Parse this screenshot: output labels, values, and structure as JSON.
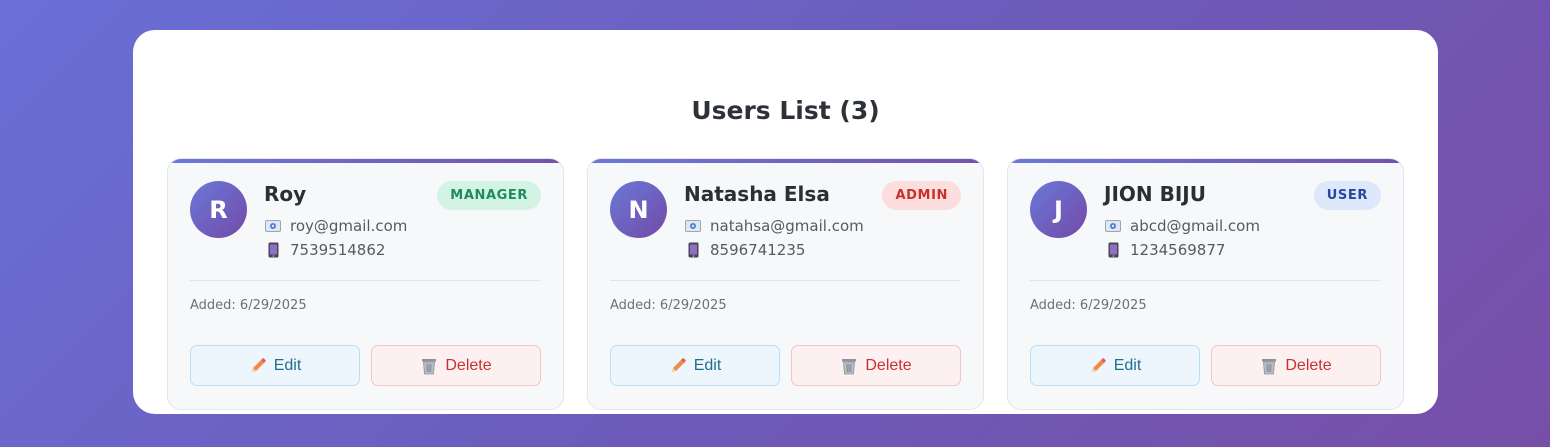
{
  "page": {
    "title": "Users List (3)"
  },
  "users": [
    {
      "initial": "R",
      "name": "Roy",
      "role": "MANAGER",
      "email": "roy@gmail.com",
      "phone": "7539514862",
      "added": "Added: 6/29/2025",
      "edit_label": "Edit",
      "delete_label": "Delete"
    },
    {
      "initial": "N",
      "name": "Natasha Elsa",
      "role": "ADMIN",
      "email": "natahsa@gmail.com",
      "phone": "8596741235",
      "added": "Added: 6/29/2025",
      "edit_label": "Edit",
      "delete_label": "Delete"
    },
    {
      "initial": "J",
      "name": "JION BIJU",
      "role": "USER",
      "email": "abcd@gmail.com",
      "phone": "1234569877",
      "added": "Added: 6/29/2025",
      "edit_label": "Edit",
      "delete_label": "Delete"
    }
  ],
  "icons": {
    "email": "email-icon",
    "phone": "phone-icon",
    "edit": "pencil-icon",
    "delete": "trash-icon"
  },
  "colors": {
    "background_start": "#6a6fd6",
    "background_end": "#774fa8",
    "manager_badge": "#1f8a5c",
    "admin_badge": "#c9302c",
    "user_badge": "#2946a3",
    "edit_text": "#1f6f8b",
    "delete_text": "#c5322f"
  }
}
